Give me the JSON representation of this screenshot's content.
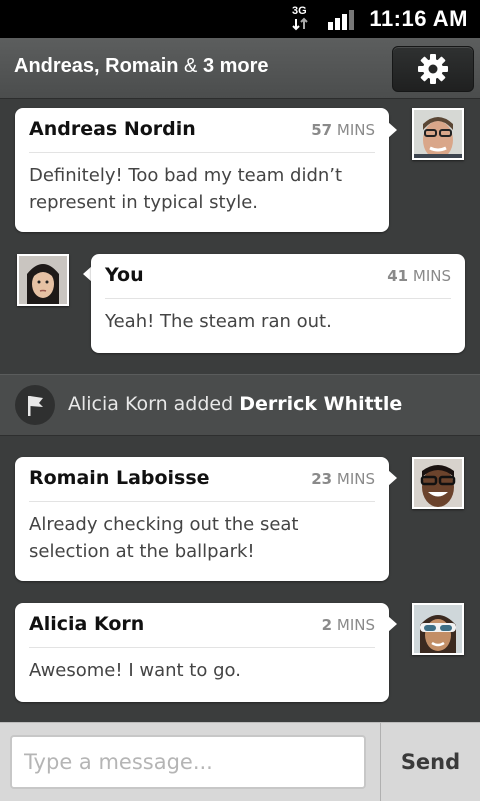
{
  "status_bar": {
    "network_label": "3G",
    "time": "11:16 AM",
    "icons": [
      "3g-data-icon",
      "signal-icon"
    ]
  },
  "header": {
    "title_names": "Andreas, Romain",
    "title_amp": "&",
    "title_more": "3 more",
    "settings_icon": "gear-icon"
  },
  "messages": [
    {
      "sender": "Andreas Nordin",
      "age_value": "57",
      "age_unit": "MINS",
      "text": "Definitely! Too bad my team didn’t represent in typical style.",
      "side": "right"
    },
    {
      "sender": "You",
      "age_value": "41",
      "age_unit": "MINS",
      "text": "Yeah! The steam ran out.",
      "side": "left"
    },
    {
      "sender": "Romain Laboisse",
      "age_value": "23",
      "age_unit": "MINS",
      "text": "Already checking out the seat selection at the ballpark!",
      "side": "right"
    },
    {
      "sender": "Alicia Korn",
      "age_value": "2",
      "age_unit": "MINS",
      "text": "Awesome! I want to go.",
      "side": "right"
    }
  ],
  "event": {
    "icon": "flag-icon",
    "actor": "Alicia Korn added",
    "target": "Derrick Whittle"
  },
  "composer": {
    "placeholder": "Type a message...",
    "send_label": "Send"
  },
  "colors": {
    "background": "#3b3d3d",
    "header": "#555757",
    "bubble": "#ffffff",
    "status_bar": "#000000"
  }
}
